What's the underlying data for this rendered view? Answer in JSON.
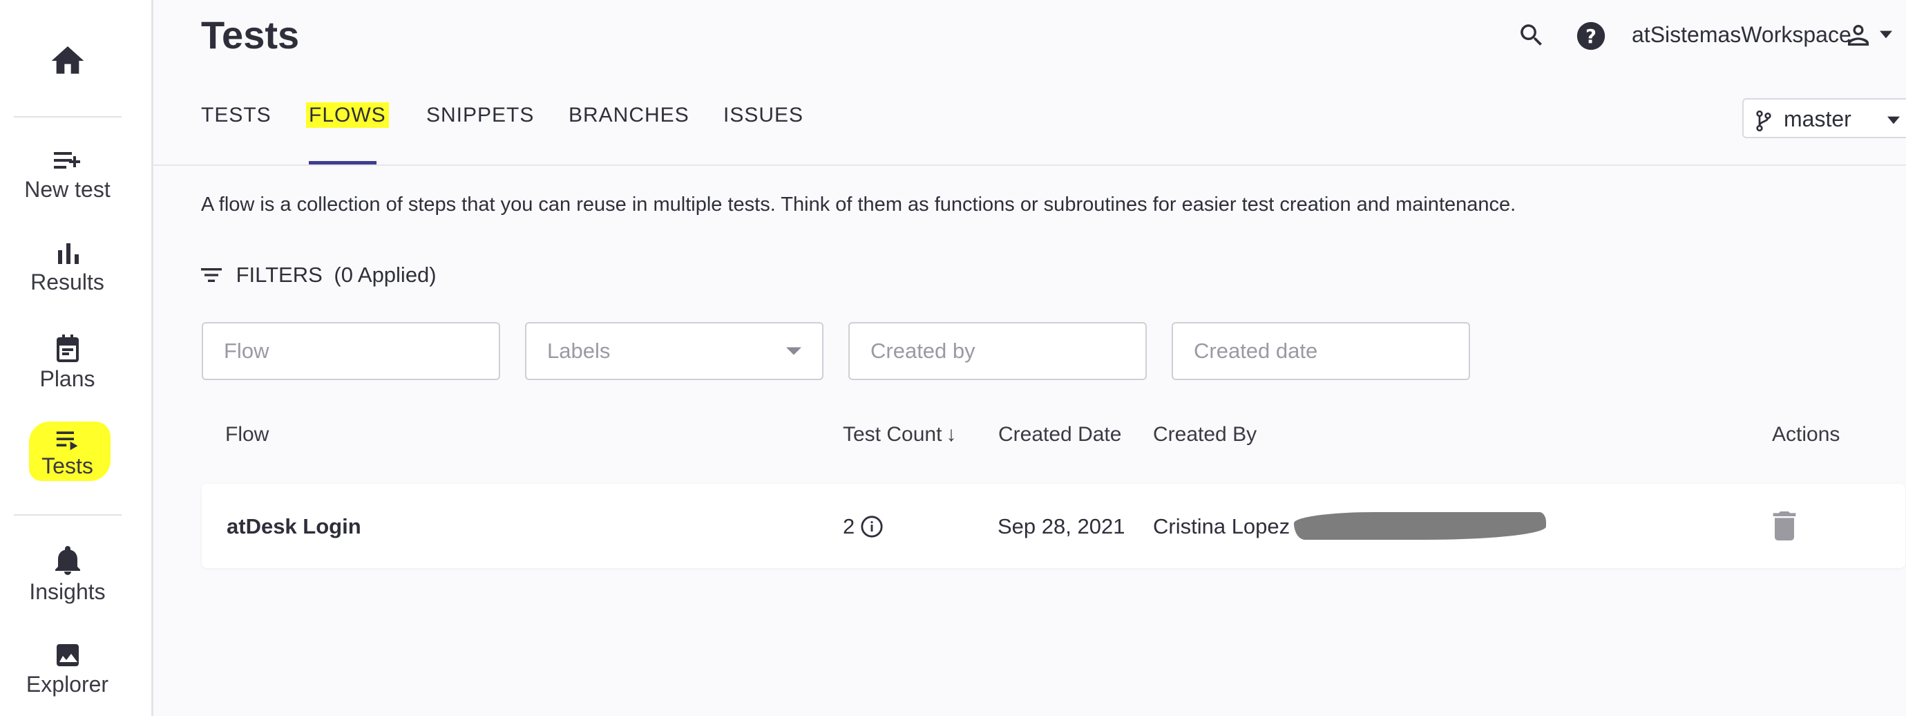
{
  "sidebar": {
    "items": [
      {
        "label": "",
        "icon": "home-icon"
      },
      {
        "label": "New test",
        "icon": "playlist-add-icon"
      },
      {
        "label": "Results",
        "icon": "bar-chart-icon"
      },
      {
        "label": "Plans",
        "icon": "calendar-note-icon"
      },
      {
        "label": "Tests",
        "icon": "playlist-play-icon",
        "active": true
      },
      {
        "label": "Insights",
        "icon": "bell-icon"
      },
      {
        "label": "Explorer",
        "icon": "image-icon"
      }
    ]
  },
  "header": {
    "title": "Tests",
    "workspace": "atSistemasWorkspace",
    "icons": [
      "search-icon",
      "help-icon",
      "user-icon",
      "caret-down-icon"
    ]
  },
  "tabs": [
    {
      "label": "TESTS"
    },
    {
      "label": "FLOWS",
      "active": true
    },
    {
      "label": "SNIPPETS"
    },
    {
      "label": "BRANCHES"
    },
    {
      "label": "ISSUES"
    }
  ],
  "branch": {
    "selected": "master",
    "icon": "git-branch-icon"
  },
  "description": "A flow is a collection of steps that you can reuse in multiple tests. Think of them as functions or subroutines for easier test creation and maintenance.",
  "filters": {
    "label": "FILTERS",
    "applied": "(0 Applied)",
    "fields": [
      {
        "placeholder": "Flow"
      },
      {
        "placeholder": "Labels"
      },
      {
        "placeholder": "Created by"
      },
      {
        "placeholder": "Created date"
      }
    ]
  },
  "table": {
    "columns": [
      "Flow",
      "Test Count",
      "Created Date",
      "Created By",
      "Actions"
    ],
    "sort_indicator": "↓",
    "rows": [
      {
        "flow": "atDesk Login",
        "test_count": "2",
        "created_date": "Sep 28, 2021",
        "created_by": "Cristina Lopez"
      }
    ]
  },
  "colors": {
    "highlight": "#ffff2a",
    "tab_underline": "#3f3d8e",
    "background": "#fafafc"
  }
}
